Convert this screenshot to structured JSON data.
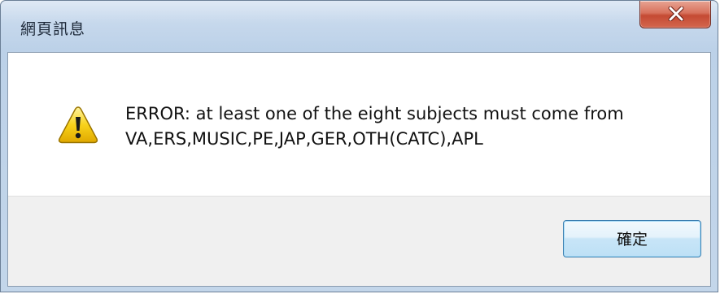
{
  "dialog": {
    "title": "網頁訊息",
    "message_line1": "ERROR: at least one of the eight subjects must come from",
    "message_line2": "VA,ERS,MUSIC,PE,JAP,GER,OTH(CATC),APL",
    "ok_label": "確定",
    "icons": {
      "close": "close-icon",
      "message": "warning-icon"
    },
    "colors": {
      "close_button": "#c44a33",
      "warning": "#f5c400",
      "ok_border": "#3c7fb1"
    }
  }
}
